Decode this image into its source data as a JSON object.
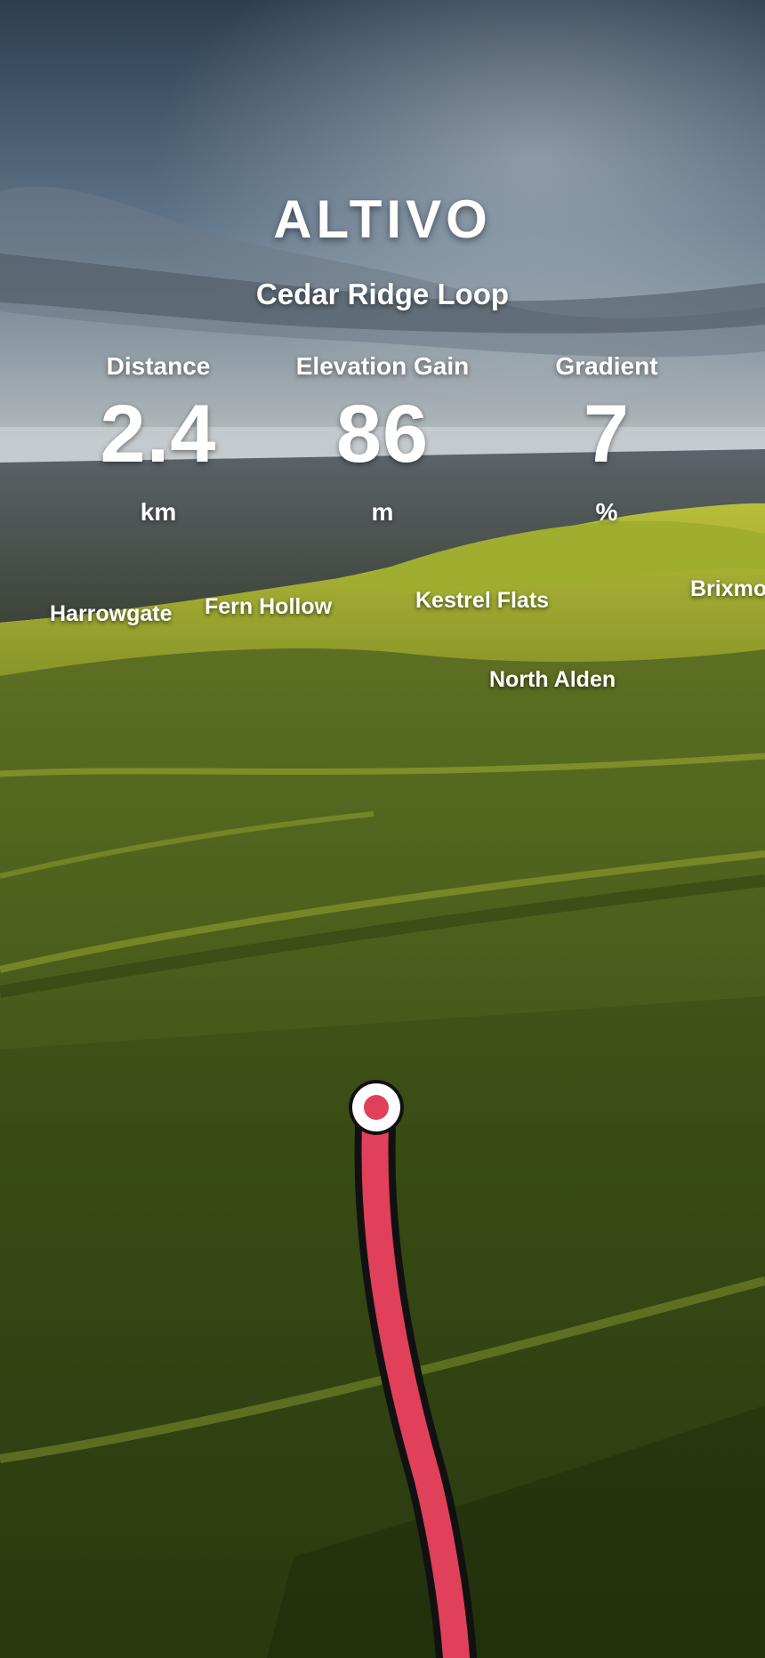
{
  "app": {
    "brand": "ALTIVO",
    "route_name": "Cedar Ridge Loop"
  },
  "stats": [
    {
      "label": "Distance",
      "value": "2.4",
      "unit": "km"
    },
    {
      "label": "Elevation Gain",
      "value": "86",
      "unit": "m"
    },
    {
      "label": "Gradient",
      "value": "7",
      "unit": "%"
    }
  ],
  "places": [
    "Harrowgate",
    "Fern Hollow",
    "Kestrel Flats",
    "Brixmo",
    "North Alden"
  ],
  "colors": {
    "route_line": "#E0405A",
    "route_outline": "#111111",
    "marker_fill": "#FFFFFF",
    "marker_center": "#E0405A",
    "sky_top": "#2E3F52",
    "grass": "#4A5E1E"
  },
  "icons": {
    "start_marker": "route-start-marker-icon"
  }
}
